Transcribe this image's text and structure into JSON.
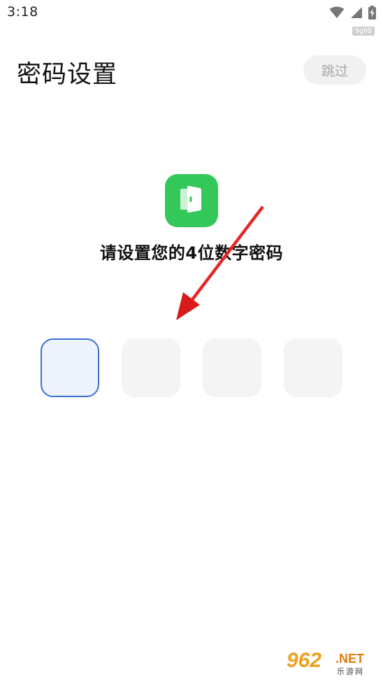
{
  "status_bar": {
    "time": "3:18",
    "tag": "9g08",
    "icons": [
      "wifi-icon",
      "signal-icon",
      "battery-charging-icon"
    ]
  },
  "header": {
    "title": "密码设置",
    "skip_label": "跳过"
  },
  "logo": {
    "icon": "door-icon",
    "color": "#34c759"
  },
  "prompt": "请设置您的4位数字密码",
  "pin": {
    "length": 4,
    "active_index": 0,
    "active_border_color": "#3b6fd4"
  },
  "annotation": {
    "arrow_color": "#e02020"
  },
  "watermark": {
    "number": "962",
    "net": ".NET",
    "sub": "乐游网"
  }
}
